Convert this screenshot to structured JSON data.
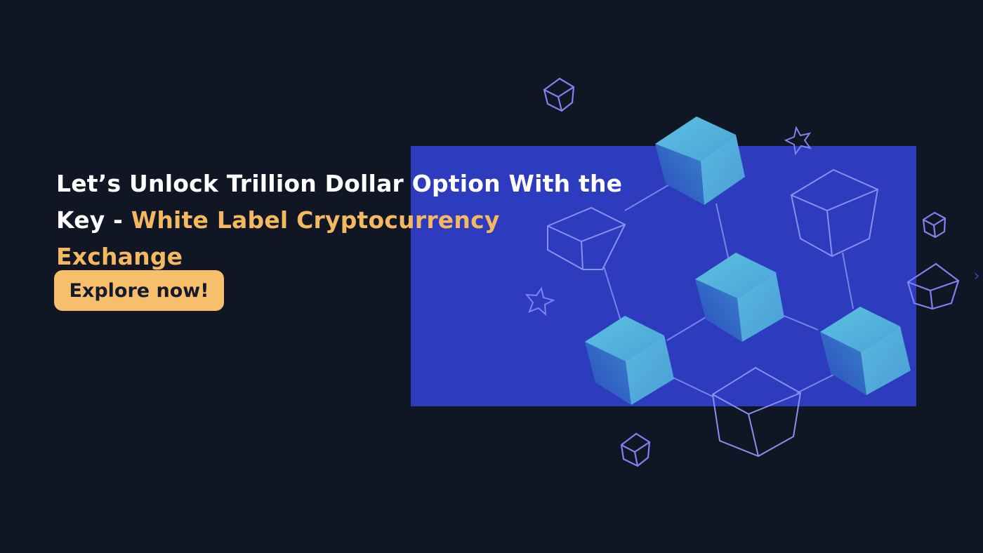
{
  "banner": {
    "headline_line1": "Let’s Unlock Trillion Dollar Option With the",
    "headline_line2_prefix": "Key - ",
    "headline_line2_accent": "White Label Cryptocurrency Exchange",
    "cta_label": "Explore now!",
    "next_icon": "›"
  },
  "colors": {
    "background": "#111624",
    "panel": "#2d3bbe",
    "accent_text": "#f4b860",
    "cta_background": "#f7bf6b",
    "cta_text": "#151a2c",
    "cube_fill": "#4fa6d6",
    "outline": "#7f82f0"
  },
  "icons": [
    "cube-icon",
    "star-icon",
    "chevron-right-icon"
  ]
}
